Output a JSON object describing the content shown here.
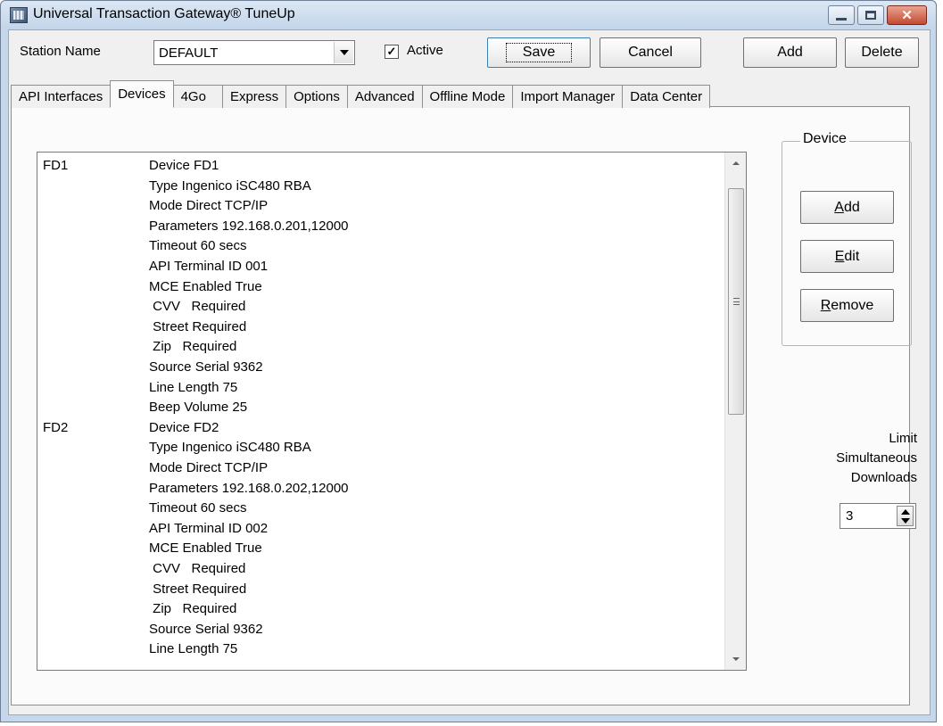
{
  "window": {
    "title": "Universal Transaction Gateway® TuneUp",
    "controls": {
      "minimize": "minimize-icon",
      "maximize": "maximize-icon",
      "close": "close-icon"
    }
  },
  "toolbar": {
    "station_label": "Station Name",
    "station_value": "DEFAULT",
    "active_label": "Active",
    "active_checked": true,
    "save_label": "Save",
    "cancel_label": "Cancel",
    "add_label": "Add",
    "delete_label": "Delete"
  },
  "tabs": [
    {
      "label": "API Interfaces",
      "active": false
    },
    {
      "label": "Devices",
      "active": true
    },
    {
      "label": "4Go",
      "active": false
    },
    {
      "label": "Express",
      "active": false
    },
    {
      "label": "Options",
      "active": false
    },
    {
      "label": "Advanced",
      "active": false
    },
    {
      "label": "Offline Mode",
      "active": false
    },
    {
      "label": "Import Manager",
      "active": false
    },
    {
      "label": "Data Center",
      "active": false
    }
  ],
  "devices_list": [
    {
      "key": "FD1",
      "text": "Device FD1"
    },
    {
      "key": "",
      "text": "Type Ingenico iSC480 RBA"
    },
    {
      "key": "",
      "text": "Mode Direct TCP/IP"
    },
    {
      "key": "",
      "text": "Parameters 192.168.0.201,12000"
    },
    {
      "key": "",
      "text": "Timeout 60 secs"
    },
    {
      "key": "",
      "text": "API Terminal ID 001"
    },
    {
      "key": "",
      "text": "MCE Enabled True"
    },
    {
      "key": "",
      "text": " CVV   Required"
    },
    {
      "key": "",
      "text": " Street Required"
    },
    {
      "key": "",
      "text": " Zip   Required"
    },
    {
      "key": "",
      "text": "Source Serial 9362"
    },
    {
      "key": "",
      "text": "Line Length 75"
    },
    {
      "key": "",
      "text": "Beep Volume 25"
    },
    {
      "key": "FD2",
      "text": "Device FD2"
    },
    {
      "key": "",
      "text": "Type Ingenico iSC480 RBA"
    },
    {
      "key": "",
      "text": "Mode Direct TCP/IP"
    },
    {
      "key": "",
      "text": "Parameters 192.168.0.202,12000"
    },
    {
      "key": "",
      "text": "Timeout 60 secs"
    },
    {
      "key": "",
      "text": "API Terminal ID 002"
    },
    {
      "key": "",
      "text": "MCE Enabled True"
    },
    {
      "key": "",
      "text": " CVV   Required"
    },
    {
      "key": "",
      "text": " Street Required"
    },
    {
      "key": "",
      "text": " Zip   Required"
    },
    {
      "key": "",
      "text": "Source Serial 9362"
    },
    {
      "key": "",
      "text": "Line Length 75"
    }
  ],
  "device_group": {
    "title": "Device",
    "add_label": "Add",
    "add_mnemonic": "A",
    "add_rest": "dd",
    "edit_mnemonic": "E",
    "edit_rest": "dit",
    "remove_mnemonic": "R",
    "remove_rest": "emove"
  },
  "limit": {
    "line1": "Limit",
    "line2": "Simultaneous",
    "line3": "Downloads",
    "value": "3"
  }
}
